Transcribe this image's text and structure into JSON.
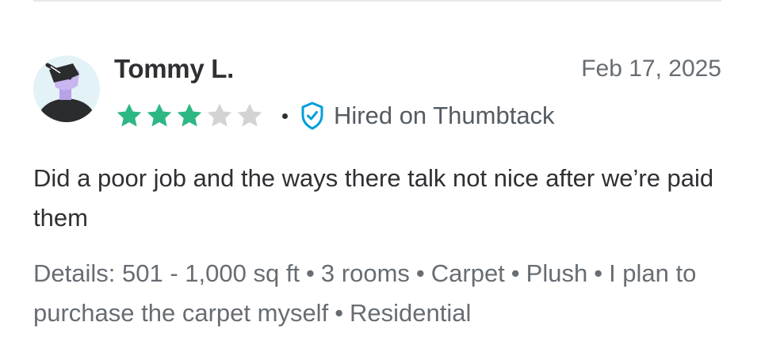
{
  "review": {
    "reviewer_name": "Tommy L.",
    "date": "Feb 17, 2025",
    "rating": 3,
    "rating_max": 5,
    "hired_label": "Hired on Thumbtack",
    "text": "Did a poor job and the ways there talk not nice after we’re paid them",
    "details_label": "Details:",
    "details": [
      "501 - 1,000 sq ft",
      "3 rooms",
      "Carpet",
      "Plush",
      "I plan to purchase the carpet myself",
      "Residential"
    ]
  },
  "colors": {
    "star_filled": "#2db783",
    "star_empty": "#d3d3d3",
    "shield": "#009fd9",
    "text_primary": "#2f3033",
    "text_secondary": "#676d73"
  },
  "icons": {
    "avatar": "user-avatar-illustration",
    "verified": "shield-check-icon",
    "star": "star-icon"
  }
}
